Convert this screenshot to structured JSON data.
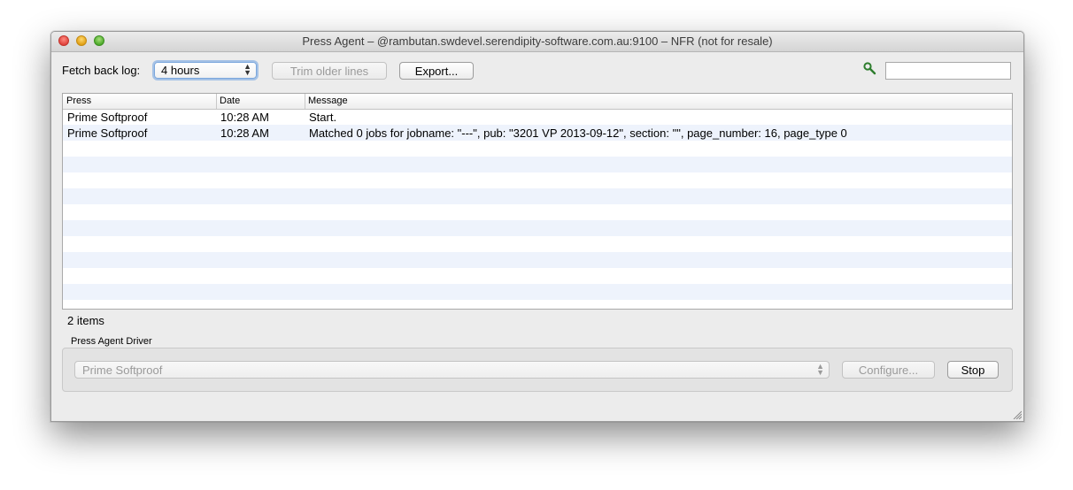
{
  "window": {
    "title": "Press Agent – @rambutan.swdevel.serendipity-software.com.au:9100 – NFR (not for resale)"
  },
  "toolbar": {
    "fetch_label": "Fetch back log:",
    "fetch_value": "4 hours",
    "trim_label": "Trim older lines",
    "export_label": "Export...",
    "search_icon": "search-icon",
    "search_value": ""
  },
  "table": {
    "columns": [
      "Press",
      "Date",
      "Message"
    ],
    "rows": [
      {
        "press": "Prime Softproof",
        "date": "10:28 AM",
        "message": "Start."
      },
      {
        "press": "Prime Softproof",
        "date": "10:28 AM",
        "message": "Matched 0 jobs for jobname: \"---\", pub: \"3201 VP 2013-09-12\", section: \"\", page_number: 16, page_type 0"
      }
    ]
  },
  "status": {
    "items": "2 items"
  },
  "driver": {
    "group_label": "Press Agent Driver",
    "selected": "Prime Softproof",
    "configure_label": "Configure...",
    "stop_label": "Stop"
  },
  "colors": {
    "row_alt": "#eef3fc",
    "focus_ring": "#6ca0e2"
  }
}
